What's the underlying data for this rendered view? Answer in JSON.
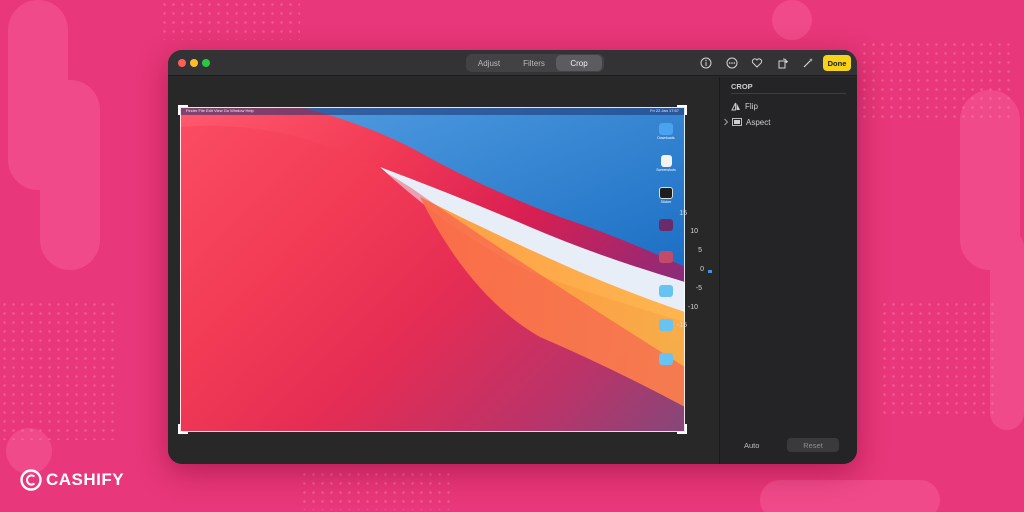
{
  "toolbar": {
    "tabs": [
      {
        "label": "Adjust",
        "active": false
      },
      {
        "label": "Filters",
        "active": false
      },
      {
        "label": "Crop",
        "active": true
      }
    ],
    "tools": [
      "info-icon",
      "more-icon",
      "favorite-heart-icon",
      "rotate-icon",
      "auto-enhance-wand-icon"
    ],
    "done_label": "Done"
  },
  "photo": {
    "menubar_items": "Finder  File  Edit  View  Go  Window  Help",
    "menubar_time": "Fri 22 Jan 17:57",
    "desktop_icons": [
      {
        "label": "Downloads",
        "icon": "cloud-icon"
      },
      {
        "label": "Screenshots",
        "icon": "document-icon"
      },
      {
        "label": "Sticker",
        "icon": "window-icon"
      },
      {
        "label": "",
        "icon": "image-icon"
      },
      {
        "label": "",
        "icon": "image-icon"
      },
      {
        "label": "",
        "icon": "folder-icon"
      },
      {
        "label": "",
        "icon": "folder-icon"
      },
      {
        "label": "",
        "icon": "folder-icon"
      }
    ]
  },
  "dial": {
    "ticks": [
      "15",
      "10",
      "5",
      "0",
      "-5",
      "-10",
      "-15"
    ],
    "current": "0"
  },
  "sidebar": {
    "heading": "CROP",
    "flip_label": "Flip",
    "aspect_label": "Aspect",
    "auto_label": "Auto",
    "reset_label": "Reset"
  },
  "watermark": {
    "brand": "CASHIFY"
  },
  "colors": {
    "background": "#e8377a",
    "done_button": "#f7d21b",
    "window": "#2a2a2c"
  }
}
